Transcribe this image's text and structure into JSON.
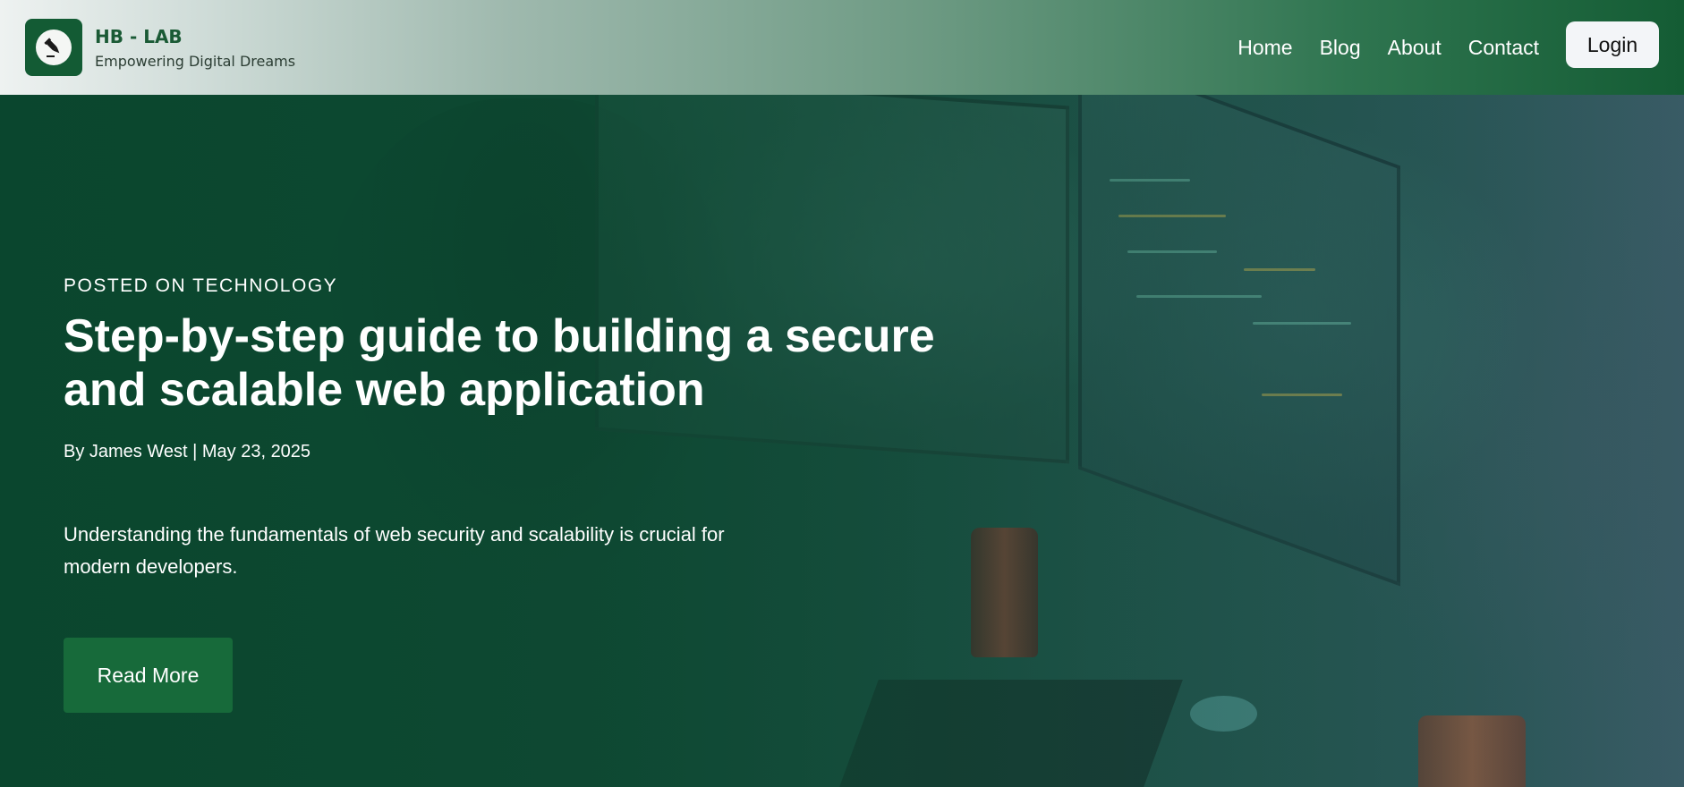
{
  "header": {
    "brand_name": "HB - LAB",
    "tagline": "Empowering Digital Dreams",
    "logo_icon": "pen-nib-icon",
    "nav": [
      {
        "label": "Home"
      },
      {
        "label": "Blog"
      },
      {
        "label": "About"
      },
      {
        "label": "Contact"
      }
    ],
    "login_label": "Login"
  },
  "hero": {
    "category": "POSTED ON TECHNOLOGY",
    "title": "Step-by-step guide to building a secure and scalable web application",
    "meta": "By James West | May 23, 2025",
    "excerpt": "Understanding the fundamentals of web security and scalability is crucial for modern developers.",
    "read_more_label": "Read More",
    "background_image": "developer-at-monitors-photo"
  },
  "colors": {
    "brand_green": "#135b34",
    "button_green": "#176a3a",
    "text_light": "#ffffff"
  }
}
